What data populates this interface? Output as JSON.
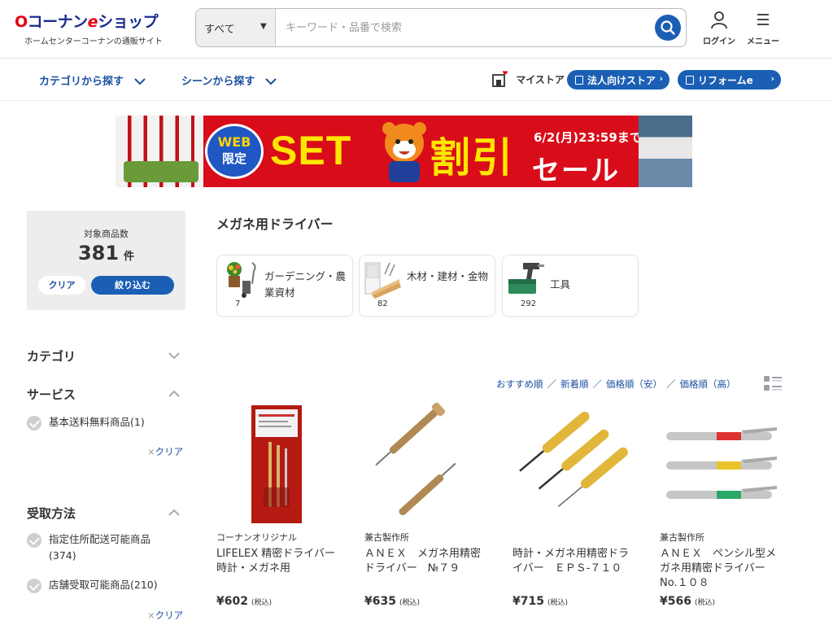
{
  "header": {
    "logo_main_o": "O",
    "logo_main_text": "コーナン",
    "logo_main_e": "e",
    "logo_main_shop": "ショップ",
    "logo_sub": "ホームセンターコーナンの通販サイト",
    "search_category": "すべて",
    "search_placeholder": "キーワード・品番で検索",
    "login_label": "ログイン",
    "menu_label": "メニュー"
  },
  "nav": {
    "category_link": "カテゴリから探す",
    "scene_link": "シーンから探す",
    "mystore_label": "マイストア",
    "corporate_store": "法人向けストア",
    "reform": "リフォームe"
  },
  "banner": {
    "badge_line1": "WEB",
    "badge_line2": "限定",
    "set_text": "SET",
    "discount_text": "割引",
    "date_text": "6/2(月)23:59まで!",
    "sale_text": "セール",
    "colors": {
      "bg": "#d90c1a",
      "accent": "#ffe600",
      "badge": "#1f57c3"
    }
  },
  "sidebar": {
    "count_label": "対象商品数",
    "count_value": "381",
    "count_unit": "件",
    "clear_button": "クリア",
    "refine_button": "絞り込む",
    "facets": [
      {
        "title": "カテゴリ",
        "expanded": false,
        "options": []
      },
      {
        "title": "サービス",
        "expanded": true,
        "options": [
          "基本送料無料商品(1)"
        ],
        "clear": "クリア"
      },
      {
        "title": "受取方法",
        "expanded": true,
        "options": [
          "指定住所配送可能商品(374)",
          "店舗受取可能商品(210)"
        ],
        "clear": "クリア"
      }
    ],
    "clear_x": "×"
  },
  "main": {
    "title": "メガネ用ドライバー",
    "categories": [
      {
        "name": "ガーデニング・農業資材",
        "count": "7",
        "icon": "gardening-icon"
      },
      {
        "name": "木材・建材・金物",
        "count": "82",
        "icon": "lumber-icon"
      },
      {
        "name": "工具",
        "count": "292",
        "icon": "tools-icon"
      }
    ],
    "sort": {
      "options": [
        "おすすめ順",
        "新着順",
        "価格順（安）",
        "価格順（高）"
      ],
      "separator": "／"
    },
    "products": [
      {
        "maker": "コーナンオリジナル",
        "name": "LIFELEX 精密ドライバー　時計・メガネ用",
        "price": "¥602",
        "tax": "(税込)"
      },
      {
        "maker": "兼古製作所",
        "name": "ＡＮＥＸ　メガネ用精密ドライバー　№７９",
        "price": "¥635",
        "tax": "(税込)"
      },
      {
        "maker": "",
        "name": "時計・メガネ用精密ドライバー　ＥＰＳ-７１０",
        "price": "¥715",
        "tax": "(税込)"
      },
      {
        "maker": "兼古製作所",
        "name": "ＡＮＥＸ　ペンシル型メガネ用精密ドライバー　No.１０８",
        "price": "¥566",
        "tax": "(税込)"
      }
    ]
  },
  "colors": {
    "brand_blue": "#1b5fb4",
    "link_blue": "#1b4fa0",
    "brand_red": "#e60012"
  }
}
